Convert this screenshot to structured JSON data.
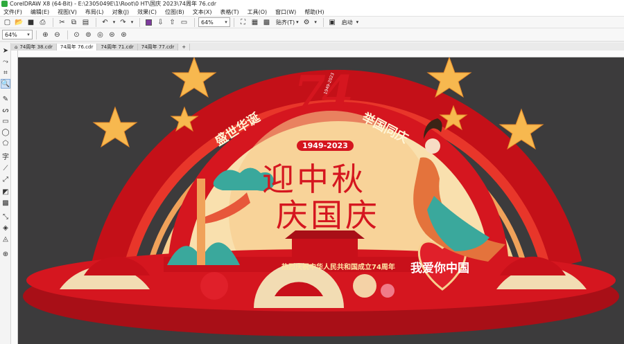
{
  "titlebar": {
    "title": "CorelDRAW X8 (64-Bit) - E:\\2305049E\\1\\Root\\0 HT\\国庆 2023\\74周年 76.cdr"
  },
  "menu": [
    "文件(F)",
    "编辑(E)",
    "视图(V)",
    "布局(L)",
    "对象(J)",
    "效果(C)",
    "位图(B)",
    "文本(X)",
    "表格(T)",
    "工具(O)",
    "窗口(W)",
    "帮助(H)"
  ],
  "toolbar": {
    "zoom_value": "64%",
    "paste_label": "贴齐(T)",
    "launch_label": "启动"
  },
  "propertybar": {
    "zoom_value": "64%"
  },
  "tabs": [
    "74周年 38.cdr",
    "74周年 76.cdr",
    "74周年 71.cdr",
    "74周年 77.cdr"
  ],
  "active_tab": "74周年 76.cdr",
  "icons": {
    "select": "pointer-icon",
    "shape": "shape-icon",
    "crop": "crop-icon",
    "zoom": "zoom-icon",
    "freehand": "freehand-icon",
    "artistic": "artistic-media-icon",
    "rectangle": "rectangle-icon",
    "ellipse": "ellipse-icon",
    "polygon": "polygon-icon",
    "text": "text-icon",
    "parallel": "dimension-icon",
    "connector": "connector-icon",
    "shadow": "shadow-icon",
    "transparency": "transparency-icon",
    "eyedropper": "eyedropper-icon",
    "fill": "fill-icon",
    "outline": "outline-icon"
  },
  "artwork": {
    "number": "74",
    "years": "1949-2023",
    "arc_left": "盛世华诞",
    "arc_right": "举国同庆",
    "main_line1": "迎中秋",
    "main_line2": "庆国庆",
    "banner": "热烈庆祝中华人民共和国成立74周年",
    "heart_text": "我爱你中国",
    "small_years": "1949-2023"
  },
  "colors": {
    "canvas_bg": "#3c3b3c",
    "red": "#d5161f",
    "dark_red": "#a80f17",
    "gold": "#f6c46e",
    "cream": "#f9e0ae",
    "teal": "#3aa89c"
  }
}
